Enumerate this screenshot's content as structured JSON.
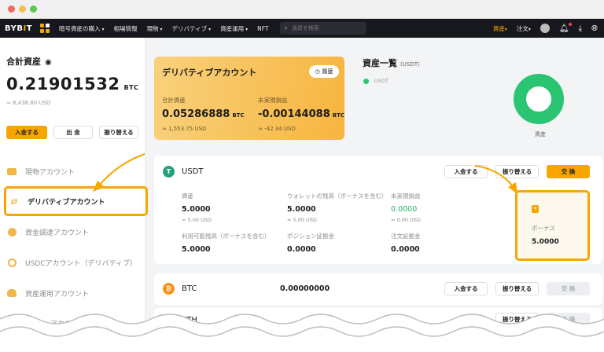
{
  "nav": {
    "logo_a": "BYB",
    "logo_b": "I",
    "logo_c": "T",
    "items": [
      "暗号資産の購入",
      "相場情報",
      "現物",
      "デリバティブ",
      "資産運用",
      "NFT"
    ],
    "search_placeholder": "通貨を検索",
    "asset": "資産",
    "orders": "注文"
  },
  "sidebar": {
    "total_label": "合計資産",
    "total_value": "0.21901532",
    "total_unit": "BTC",
    "total_usd": "≈ 6,436.80 USD",
    "deposit": "入金する",
    "withdraw": "出 金",
    "transfer": "振り替える",
    "items": [
      "現物アカウント",
      "デリバティブアカウント",
      "資金調達アカウント",
      "USDCアカウント（デリバティブ）",
      "資産運用アカウント",
      "アカウント"
    ]
  },
  "derivatives": {
    "title": "デリバティブアカウント",
    "history": "履歴",
    "total_label": "合計資産",
    "total_value": "0.05286888",
    "total_unit": "BTC",
    "total_usd": "≈ 1,553.75 USD",
    "pnl_label": "未実現損益",
    "pnl_value": "-0.00144088",
    "pnl_unit": "BTC",
    "pnl_usd": "≈ -42.34 USD"
  },
  "overview": {
    "title": "資産一覧",
    "unit": "(USDT)",
    "legend": "USDT",
    "donut_label": "資産"
  },
  "usdt": {
    "coin": "USDT",
    "deposit": "入金する",
    "transfer": "振り替える",
    "exchange": "交 換",
    "equity_label": "資産",
    "equity_value": "5.0000",
    "equity_usd": "≈ 5.00 USD",
    "wallet_label": "ウォレットの残高（ボーナスを含む）",
    "wallet_value": "5.0000",
    "wallet_usd": "≈ 5.00 USD",
    "upnl_label": "未実現損益",
    "upnl_value": "0.0000",
    "upnl_usd": "≈ 0.00 USD",
    "available_label": "利用可能残高（ボーナスを含む）",
    "available_value": "5.0000",
    "position_label": "ポジション証拠金",
    "position_value": "0.0000",
    "order_label": "注文証拠金",
    "order_value": "0.0000",
    "bonus_label": "ボーナス",
    "bonus_value": "5.0000"
  },
  "btc": {
    "coin": "BTC",
    "value": "0.00000000",
    "deposit": "入金する",
    "transfer": "振り替える",
    "exchange": "交 換"
  },
  "eth": {
    "coin": "ETH",
    "transfer": "振り替える",
    "exchange": "交 換"
  },
  "colors": {
    "accent": "#f7a600",
    "green": "#2bc572",
    "usdt": "#26a17b",
    "btc": "#f7931a"
  }
}
